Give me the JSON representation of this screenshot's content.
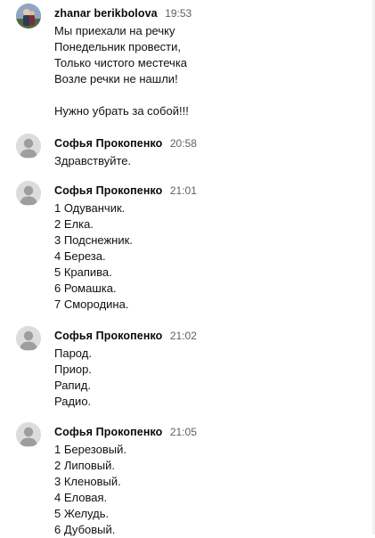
{
  "comments": [
    {
      "author": "zhanar berikbolova",
      "time": "19:53",
      "avatar": "photo-avatar",
      "lines": [
        "Мы приехали на речку",
        "Понедельник провести,",
        "Только чистого местечка",
        "Возле речки не нашли!",
        "",
        "Нужно убрать за собой!!!"
      ]
    },
    {
      "author": "Софья Прокопенко",
      "time": "20:58",
      "avatar": "default-user-avatar",
      "lines": [
        "Здравствуйте."
      ]
    },
    {
      "author": "Софья Прокопенко",
      "time": "21:01",
      "avatar": "default-user-avatar",
      "lines": [
        "1 Одуванчик.",
        "2 Елка.",
        "3 Подснежник.",
        "4 Береза.",
        "5 Крапива.",
        "6 Ромашка.",
        "7 Смородина."
      ]
    },
    {
      "author": "Софья Прокопенко",
      "time": "21:02",
      "avatar": "default-user-avatar",
      "lines": [
        "Парод.",
        "Приор.",
        "Рапид.",
        "Радио."
      ]
    },
    {
      "author": "Софья Прокопенко",
      "time": "21:05",
      "avatar": "default-user-avatar",
      "lines": [
        "1 Березовый.",
        "2 Липовый.",
        "3 Кленовый.",
        "4 Еловая.",
        "5 Желудь.",
        "6 Дубовый."
      ]
    }
  ],
  "colors": {
    "author": "#0a0a0a",
    "time": "#606060",
    "text": "#111111",
    "avatar_bg": "#dcdcdc",
    "avatar_fg": "#9e9e9e"
  }
}
